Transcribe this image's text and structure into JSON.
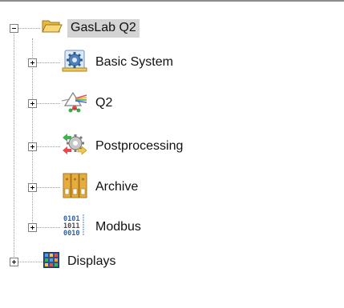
{
  "tree": {
    "root": {
      "label": "GasLab Q2",
      "icon": "folder-open-icon",
      "expanded": true,
      "selected": true
    },
    "children": [
      {
        "label": "Basic System",
        "icon": "settings-gear-icon",
        "expanded": false
      },
      {
        "label": "Q2",
        "icon": "prism-spectrum-icon",
        "expanded": false
      },
      {
        "label": "Postprocessing",
        "icon": "processing-gears-icon",
        "expanded": false
      },
      {
        "label": "Archive",
        "icon": "archive-binders-icon",
        "expanded": false
      },
      {
        "label": "Modbus",
        "icon": "binary-data-icon",
        "expanded": false
      }
    ],
    "sibling": {
      "label": "Displays",
      "icon": "display-grid-icon",
      "expanded": false
    }
  },
  "colors": {
    "selection": "#d4d4d4",
    "tree_lines": "#9a9a9a",
    "folder": "#f2c94c",
    "archive": "#e0a83a"
  }
}
